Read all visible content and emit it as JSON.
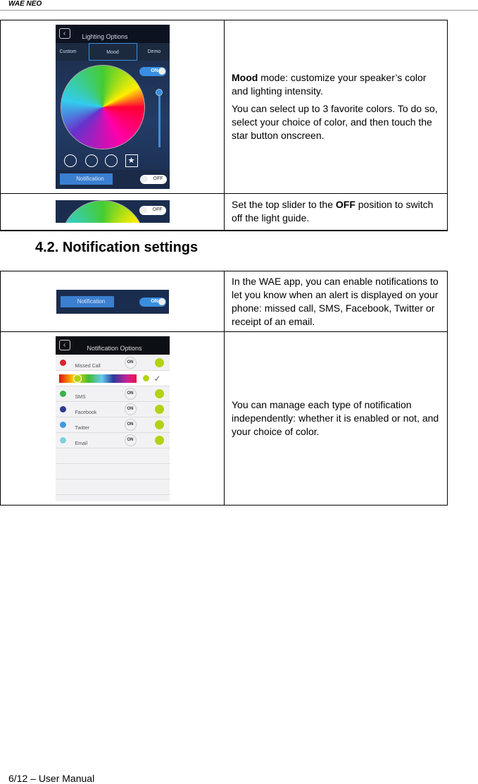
{
  "header": {
    "title": "WAE NEO"
  },
  "section1": {
    "rows": [
      {
        "screen": {
          "title": "Lighting Options",
          "tabs": [
            "Custom",
            "Mood",
            "Demo"
          ],
          "toggle": "ON",
          "notification": "Notification",
          "notification_toggle": "OFF"
        },
        "bold": "Mood",
        "text": " mode: customize your speaker’s color and lighting intensity.",
        "text2": "You can select up to 3 favorite colors. To do so, select your choice of color, and then touch the star button onscreen."
      },
      {
        "screen": {
          "toggle": "OFF"
        },
        "pre": "Set the top slider to the ",
        "bold": "OFF",
        "post": " position to switch off the light guide."
      }
    ]
  },
  "heading": "4.2.  Notification settings",
  "section2": {
    "rows": [
      {
        "screen": {
          "notification": "Notification",
          "toggle": "ON"
        },
        "text": "In the WAE app, you can enable notifications to let you know when an alert is displayed on your phone: missed call, SMS, Facebook, Twitter or receipt of an email."
      },
      {
        "screen": {
          "title": "Notification Options",
          "on": "ON",
          "items": [
            {
              "label": "Missed Call",
              "color": "#d8232a"
            },
            {
              "label": "SMS",
              "color": "#3bb34a"
            },
            {
              "label": "Facebook",
              "color": "#2b3a8c"
            },
            {
              "label": "Twitter",
              "color": "#3d9ae0"
            },
            {
              "label": "Email",
              "color": "#7fd0dc"
            }
          ]
        },
        "text": "You can manage each type of notification independently: whether it is enabled or not, and your choice of color."
      }
    ]
  },
  "footer": "6/12 – User Manual"
}
